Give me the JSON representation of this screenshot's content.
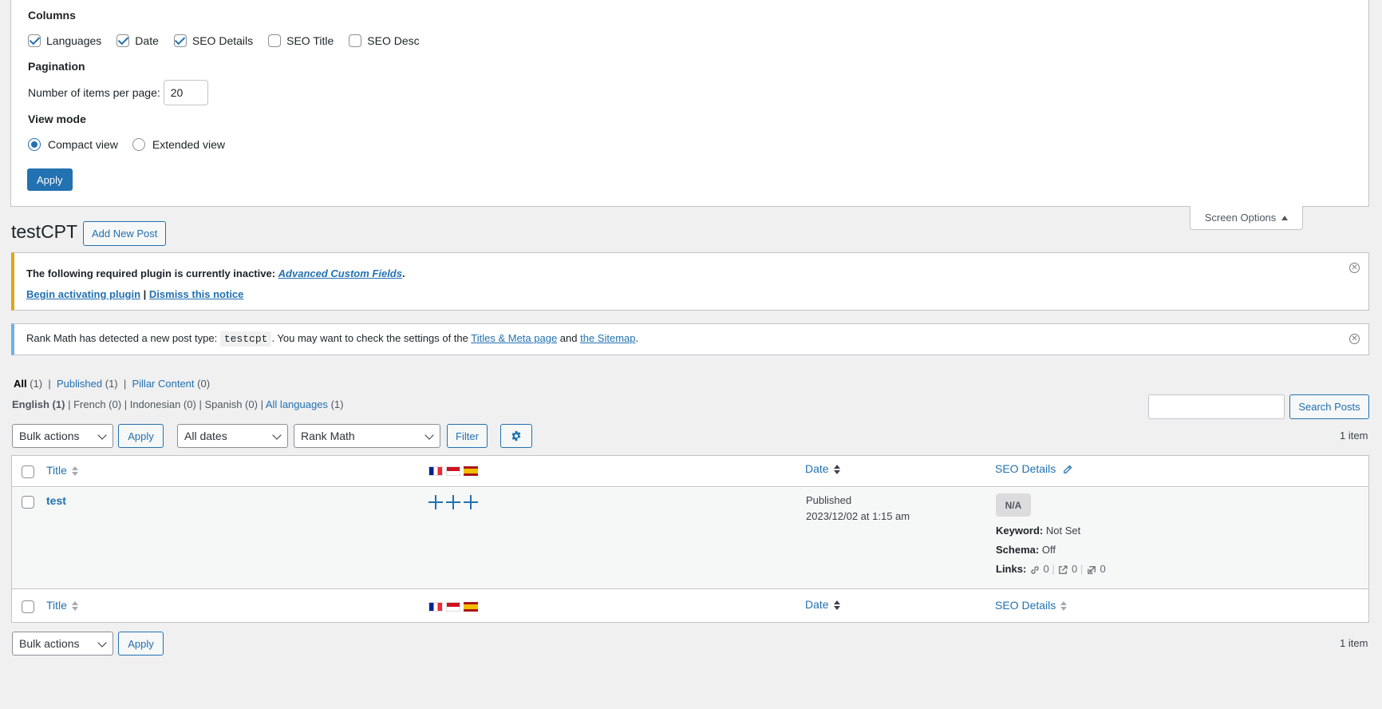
{
  "screen_options": {
    "columns_heading": "Columns",
    "columns": [
      {
        "label": "Languages",
        "checked": true
      },
      {
        "label": "Date",
        "checked": true
      },
      {
        "label": "SEO Details",
        "checked": true
      },
      {
        "label": "SEO Title",
        "checked": false
      },
      {
        "label": "SEO Desc",
        "checked": false
      }
    ],
    "pagination_heading": "Pagination",
    "per_page_label": "Number of items per page:",
    "per_page_value": "20",
    "view_mode_heading": "View mode",
    "view_modes": [
      {
        "label": "Compact view",
        "checked": true
      },
      {
        "label": "Extended view",
        "checked": false
      }
    ],
    "apply_label": "Apply",
    "tab_label": "Screen Options"
  },
  "page": {
    "title": "testCPT",
    "add_new_label": "Add New Post"
  },
  "notice_plugin": {
    "text": "The following required plugin is currently inactive:",
    "plugin_link": "Advanced Custom Fields",
    "period": ".",
    "activate_link": "Begin activating plugin",
    "separator": "|",
    "dismiss_link": "Dismiss this notice"
  },
  "notice_rankmath": {
    "text_before": "Rank Math has detected a new post type:",
    "post_type": "testcpt",
    "text_middle": ". You may want to check the settings of the",
    "titles_link": "Titles & Meta page",
    "and": "and",
    "sitemap_link": "the Sitemap",
    "period": "."
  },
  "status_filters": {
    "all_label": "All",
    "all_count": "(1)",
    "published_label": "Published",
    "published_count": "(1)",
    "pillar_label": "Pillar Content",
    "pillar_count": "(0)",
    "sep": "|"
  },
  "language_filters": {
    "english": "English (1)",
    "french": "French (0)",
    "indonesian": "Indonesian (0)",
    "spanish": "Spanish (0)",
    "all_label": "All languages",
    "all_count": "(1)",
    "sep": "|"
  },
  "search": {
    "value": "",
    "button_label": "Search Posts"
  },
  "tablenav_top": {
    "bulk_actions": "Bulk actions",
    "apply_label": "Apply",
    "dates": "All dates",
    "rank_math": "Rank Math",
    "filter_label": "Filter",
    "count": "1 item"
  },
  "table": {
    "col_title": "Title",
    "col_date": "Date",
    "col_seo": "SEO Details",
    "row": {
      "title": "test",
      "status": "Published",
      "date": "2023/12/02 at 1:15 am",
      "seo_score": "N/A",
      "keyword_label": "Keyword:",
      "keyword_value": "Not Set",
      "schema_label": "Schema:",
      "schema_value": "Off",
      "links_label": "Links:",
      "internal_links": "0",
      "external_links": "0",
      "incoming_links": "0",
      "link_sep": "|"
    }
  },
  "tablenav_bottom": {
    "bulk_actions": "Bulk actions",
    "apply_label": "Apply",
    "count": "1 item"
  },
  "colors": {
    "accent": "#2271b1",
    "warning_border": "#dba617",
    "info_border": "#72aee6"
  }
}
